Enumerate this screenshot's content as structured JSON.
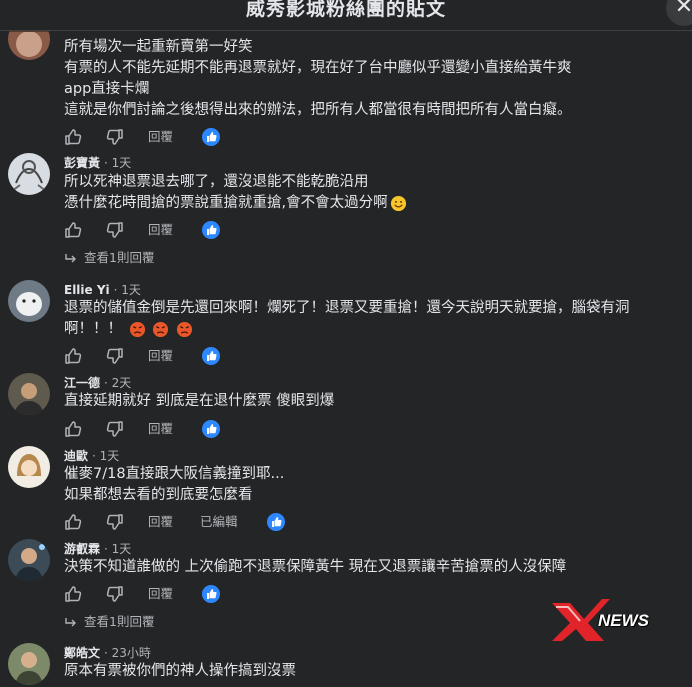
{
  "header": {
    "title": "威秀影城粉絲團的貼文",
    "close_symbol": "✕"
  },
  "labels": {
    "reply": "回覆",
    "edited": "已編輯",
    "view_one_reply": "查看1則回覆"
  },
  "comments": [
    {
      "author": "",
      "time": "",
      "lines": [
        "所有場次一起重新賣第一好笑",
        "有票的人不能先延期不能再退票就好，現在好了台中廳似乎還變小直接給黃牛爽",
        "app直接卡爛",
        "這就是你們討論之後想得出來的辦法，把所有人都當很有時間把所有人當白癡。"
      ]
    },
    {
      "author": "彭寶黃",
      "time": "· 1天",
      "lines": [
        "所以死神退票退去哪了，還沒退能不能乾脆沿用",
        "憑什麼花時間搶的票說重搶就重搶,會不會太過分啊"
      ],
      "emoji": "smiling-face"
    },
    {
      "author": "Ellie Yi",
      "time": "· 1天",
      "lines": [
        "退票的儲值金倒是先還回來啊！爛死了！退票又要重搶！還今天說明天就要搶，腦袋有洞",
        "啊！！！"
      ],
      "emoji": "angry-face x3"
    },
    {
      "author": "江一德",
      "time": "· 2天",
      "lines": [
        "直接延期就好 到底是在退什麼票 傻眼到爆"
      ]
    },
    {
      "author": "迪歐",
      "time": "· 1天",
      "lines": [
        "催麥7/18直接跟大阪信義撞到耶...",
        "如果都想去看的到底要怎麼看"
      ]
    },
    {
      "author": "游叡霖",
      "time": "· 1天",
      "lines": [
        "決策不知道誰做的 上次偷跑不退票保障黃牛 現在又退票讓辛苦搶票的人沒保障"
      ]
    },
    {
      "author": "鄭皓文",
      "time": "· 23小時",
      "lines": [
        "原本有票被你們的神人操作搞到沒票"
      ]
    }
  ],
  "watermark": {
    "text": "NEWS",
    "brand_color": "#e0242a"
  },
  "colors": {
    "background": "#242526",
    "text": "#e4e6eb",
    "secondary": "#b0b3b8",
    "like_blue": "#2d88ff"
  }
}
